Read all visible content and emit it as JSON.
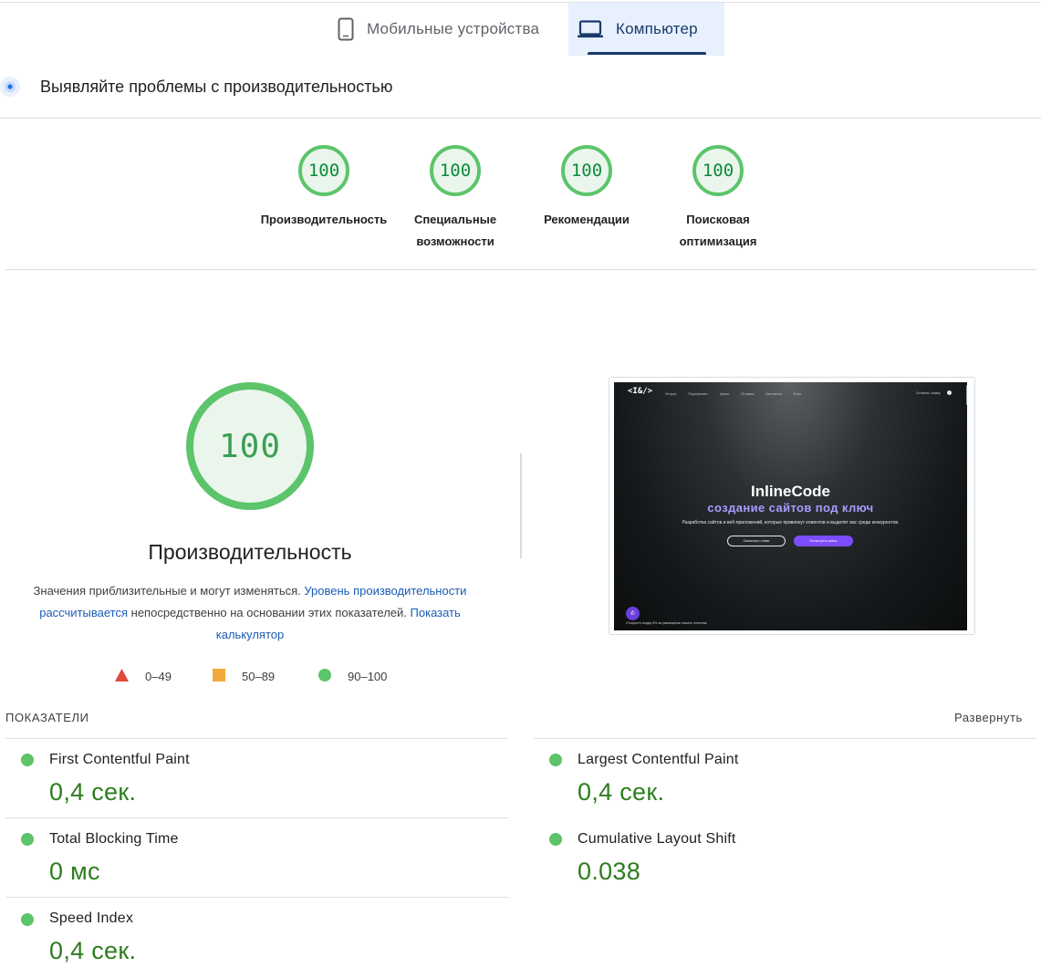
{
  "device_tabs": [
    {
      "label": "Мобильные устройства",
      "icon": "phone-icon",
      "selected": false
    },
    {
      "label": "Компьютер",
      "icon": "laptop-icon",
      "selected": true
    }
  ],
  "diagnose": {
    "title": "Выявляйте проблемы с производительностью",
    "icon": "lighthouse-icon"
  },
  "categories": [
    {
      "score": "100",
      "label_line1": "Производительность",
      "label_line2": ""
    },
    {
      "score": "100",
      "label_line1": "Специальные",
      "label_line2": "возможности"
    },
    {
      "score": "100",
      "label_line1": "Рекомендации",
      "label_line2": ""
    },
    {
      "score": "100",
      "label_line1": "Поисковая",
      "label_line2": "оптимизация"
    }
  ],
  "performance": {
    "score": "100",
    "score_fraction": 1.0,
    "title": "Производительность",
    "desc_part1": "Значения приблизительные и могут изменяться.",
    "desc_link1": "Уровень производительности рассчитывается",
    "desc_part2": "непосредственно на основании этих показателей.",
    "desc_link2": "Показать калькулятор"
  },
  "legend": [
    {
      "range": "0–49",
      "shape": "triangle",
      "color": "#e0483c"
    },
    {
      "range": "50–89",
      "shape": "square",
      "color": "#f0a93a"
    },
    {
      "range": "90–100",
      "shape": "circle",
      "color": "#5cc46a"
    }
  ],
  "preview": {
    "logo": "<I&/>",
    "menu": [
      "Услуги",
      "Портфолио",
      "Цены",
      "Отзывы",
      "Контакты",
      "Блог"
    ],
    "cta": "Оставить заявку",
    "heading": "InlineCode",
    "subheading": "создание сайтов под ключ",
    "paragraph": "Разработка сайтов и веб-приложений, которые привлекут клиентов и выделят вас среди конкурентов.",
    "button_contact": "Связаться с нами",
    "button_cases": "Посмотреть кейсы",
    "footer_note": "•Получите скидку 5% за размещение нашего логотипа."
  },
  "metrics": {
    "title": "ПОКАЗАТЕЛИ",
    "expand_label": "Развернуть",
    "items": [
      {
        "name": "First Contentful Paint",
        "value": "0,4 сек.",
        "color": "#5cc46a"
      },
      {
        "name": "Largest Contentful Paint",
        "value": "0,4 сек.",
        "color": "#5cc46a"
      },
      {
        "name": "Total Blocking Time",
        "value": "0 мс",
        "color": "#5cc46a"
      },
      {
        "name": "Cumulative Layout Shift",
        "value": "0.038",
        "color": "#5cc46a"
      },
      {
        "name": "Speed Index",
        "value": "0,4 сек.",
        "color": "#5cc46a"
      }
    ]
  }
}
